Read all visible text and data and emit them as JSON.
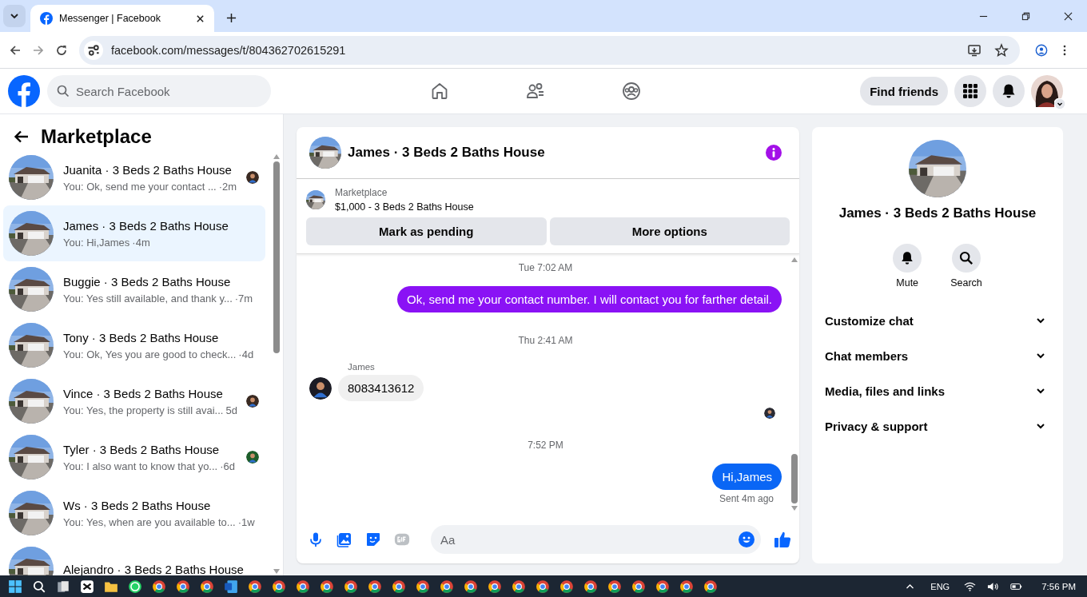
{
  "browser": {
    "tab": {
      "title": "Messenger | Facebook"
    },
    "address": "facebook.com/messages/t/804362702615291"
  },
  "header": {
    "search": {
      "placeholder": "Search Facebook"
    },
    "find_friends": "Find friends"
  },
  "sidebar": {
    "title": "Marketplace",
    "conversations": [
      {
        "name": "Juanita · 3 Beds 2 Baths House",
        "preview": "You: Ok, send me your contact ...",
        "time": "·2m",
        "selected": false,
        "seen": true
      },
      {
        "name": "James · 3 Beds 2 Baths House",
        "preview": "You: Hi,James",
        "time": "·4m",
        "selected": true,
        "seen": false
      },
      {
        "name": "Buggie · 3 Beds 2 Baths House",
        "preview": "You: Yes still available, and thank y...",
        "time": "·7m",
        "selected": false,
        "seen": false
      },
      {
        "name": "Tony · 3 Beds 2 Baths House",
        "preview": "You: Ok, Yes you are good to check...",
        "time": "·4d",
        "selected": false,
        "seen": false
      },
      {
        "name": "Vince · 3 Beds 2 Baths House",
        "preview": "You: Yes, the property is still avai...",
        "time": "5d",
        "selected": false,
        "seen": true
      },
      {
        "name": "Tyler · 3 Beds 2 Baths House",
        "preview": "You: I also want to know that yo...",
        "time": "·6d",
        "selected": false,
        "seen": true
      },
      {
        "name": "Ws · 3 Beds 2 Baths House",
        "preview": "You: Yes, when are you available to...",
        "time": "·1w",
        "selected": false,
        "seen": false
      },
      {
        "name": "Alejandro · 3 Beds 2 Baths House",
        "selected": false,
        "seen": false
      }
    ]
  },
  "chat": {
    "title": "James · 3 Beds 2 Baths House",
    "listing": {
      "label": "Marketplace",
      "text": "$1,000 - 3 Beds 2 Baths House"
    },
    "buttons": [
      "Mark as pending",
      "More options"
    ],
    "messages": [
      {
        "kind": "time",
        "text": "Tue 7:02 AM"
      },
      {
        "kind": "outgoing",
        "text": "Ok, send me your contact number. I will contact you for farther detail.",
        "color": "#8a12f5"
      },
      {
        "kind": "time",
        "text": "Thu 2:41 AM"
      },
      {
        "kind": "incoming",
        "sender": "James",
        "text": "8083413612"
      },
      {
        "kind": "seen"
      },
      {
        "kind": "time",
        "text": "7:52 PM"
      },
      {
        "kind": "outgoing",
        "text": "Hi,James",
        "color": "#0a66f5",
        "status": "Sent 4m ago"
      }
    ],
    "composer": {
      "placeholder": "Aa"
    }
  },
  "details": {
    "title": "James · 3 Beds 2 Baths House",
    "actions": [
      {
        "kind": "mute",
        "label": "Mute"
      },
      {
        "kind": "search",
        "label": "Search"
      }
    ],
    "sections": [
      {
        "label": "Customize chat",
        "expanded": false
      },
      {
        "label": "Chat members",
        "expanded": false
      },
      {
        "label": "Media, files and links",
        "expanded": false
      },
      {
        "label": "Privacy & support",
        "expanded": false
      }
    ]
  },
  "taskbar": {
    "language": "ENG",
    "time": "7:56 PM"
  }
}
